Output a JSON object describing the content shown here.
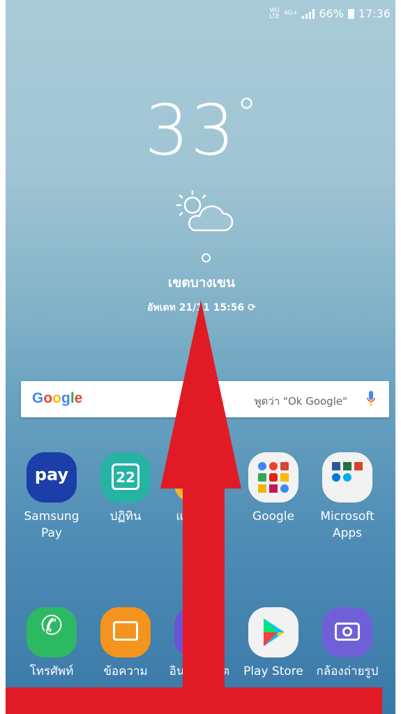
{
  "status": {
    "network1": "VoLTE",
    "network2": "4G+",
    "battery": "66%",
    "time": "17:36"
  },
  "weather": {
    "temperature": "33",
    "degree": "°",
    "location": "เขตบางเขน",
    "updated": "อัพเดท 21/11 15:56"
  },
  "search": {
    "logo": "Google",
    "hint": "พูดว่า \"Ok Google\""
  },
  "apps_row": [
    {
      "label": "Samsung Pay",
      "icon": "samsung-pay-icon"
    },
    {
      "label": "ปฏิทิน",
      "icon": "calendar-icon",
      "day": "22"
    },
    {
      "label": "แกลเลอรี่",
      "icon": "gallery-icon"
    },
    {
      "label": "Google",
      "icon": "google-folder-icon"
    },
    {
      "label": "Microsoft Apps",
      "icon": "microsoft-folder-icon"
    }
  ],
  "dock": [
    {
      "label": "โทรศัพท์",
      "icon": "phone-icon"
    },
    {
      "label": "ข้อความ",
      "icon": "message-icon"
    },
    {
      "label": "อินเทอร์เน็ต",
      "icon": "internet-icon"
    },
    {
      "label": "Play Store",
      "icon": "play-store-icon"
    },
    {
      "label": "กล้องถ่ายรูป",
      "icon": "camera-icon"
    }
  ],
  "colors": {
    "pay": "#1b3ea8",
    "calendar": "#27b3a4",
    "phone": "#2db863",
    "message": "#f5931f",
    "internet": "#6b53d6",
    "camera": "#7060d8",
    "arrow": "#e11b25"
  },
  "overlay": {
    "type": "swipe-up-arrow"
  }
}
